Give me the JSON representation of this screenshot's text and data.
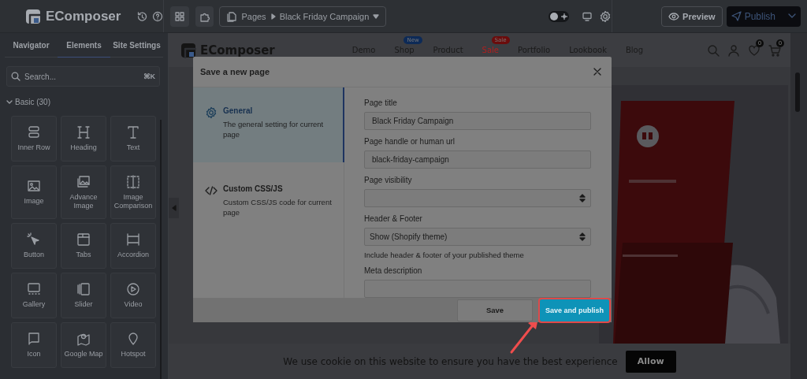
{
  "topbar": {
    "logo": "EComposer",
    "page_selector": {
      "section": "Pages",
      "page": "Black Friday Campaign"
    },
    "theme_toggle": {
      "on": false
    },
    "preview_button": "Preview",
    "publish_button": "Publish"
  },
  "sidebar": {
    "tabs": [
      {
        "label": "Navigator",
        "selected": false
      },
      {
        "label": "Elements",
        "selected": true
      },
      {
        "label": "Site Settings",
        "selected": false
      }
    ],
    "search": {
      "placeholder": "Search...",
      "shortcut": "⌘K"
    },
    "category": {
      "label": "Basic (30)",
      "expanded": true
    },
    "elements": [
      {
        "label": "Inner Row"
      },
      {
        "label": "Heading"
      },
      {
        "label": "Text"
      },
      {
        "label": "Image"
      },
      {
        "label": "Advance Image"
      },
      {
        "label": "Image Comparison"
      },
      {
        "label": "Button"
      },
      {
        "label": "Tabs"
      },
      {
        "label": "Accordion"
      },
      {
        "label": "Gallery"
      },
      {
        "label": "Slider"
      },
      {
        "label": "Video"
      },
      {
        "label": "Icon"
      },
      {
        "label": "Google Map"
      },
      {
        "label": "Hotspot"
      }
    ]
  },
  "site_header": {
    "logo": "EComposer",
    "nav": [
      {
        "label": "Demo",
        "highlighted": false
      },
      {
        "label": "Shop",
        "highlighted": false,
        "badge": {
          "text": "New",
          "color": "#0d2a57"
        }
      },
      {
        "label": "Product",
        "highlighted": false
      },
      {
        "label": "Sale",
        "highlighted": true,
        "badge": {
          "text": "Sale",
          "color": "#6b0c0c"
        }
      },
      {
        "label": "Portfolio",
        "highlighted": false
      },
      {
        "label": "Lookbook",
        "highlighted": false
      },
      {
        "label": "Blog",
        "highlighted": false
      }
    ],
    "wishlist_count": "0",
    "cart_count": "0"
  },
  "modal": {
    "title": "Save a new page",
    "sections": [
      {
        "title": "General",
        "description": "The general setting for current page",
        "selected": true
      },
      {
        "title": "Custom CSS/JS",
        "description": "Custom CSS/JS code for current page",
        "selected": false
      }
    ],
    "fields": [
      {
        "kind": "text",
        "label": "Page title",
        "value": "Black Friday Campaign"
      },
      {
        "kind": "text",
        "label": "Page handle or human url",
        "value": "black-friday-campaign"
      },
      {
        "kind": "select",
        "label": "Page visibility"
      },
      {
        "kind": "select",
        "label": "Header & Footer",
        "value": "Show (Shopify theme)",
        "help": "Include header & footer of your published theme"
      },
      {
        "kind": "text",
        "label": "Meta description"
      }
    ],
    "buttons": [
      {
        "label": "Save",
        "kind": "secondary",
        "highlighted": false
      },
      {
        "label": "Save and publish",
        "kind": "primary",
        "highlighted": true
      }
    ]
  },
  "cookie_bar": {
    "text": "We use cookie on this website to ensure you have the best experience",
    "button": "Allow"
  }
}
